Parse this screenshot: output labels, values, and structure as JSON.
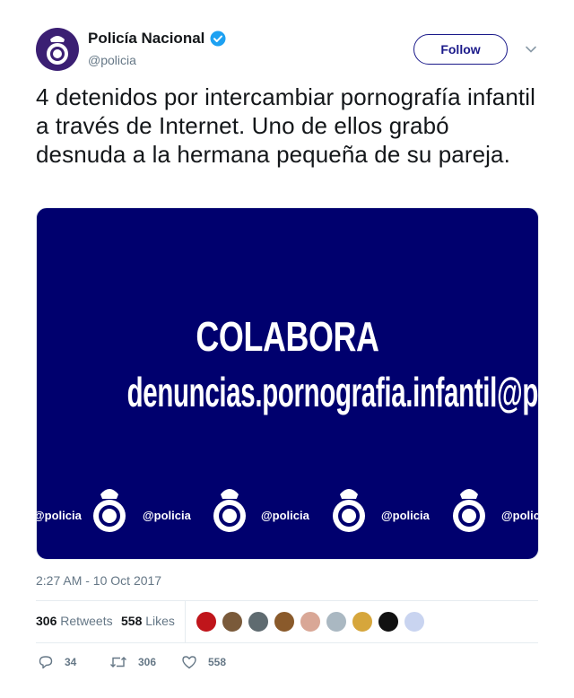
{
  "user": {
    "display_name": "Policía Nacional",
    "handle": "@policia",
    "verified": true,
    "avatar_icon": "police-crest-icon"
  },
  "follow_label": "Follow",
  "tweet_text": "4 detenidos por intercambiar pornografía infantil a través de Internet. Uno de ellos grabó desnuda a la hermana pequeña de su pareja.",
  "media": {
    "headline": "COLABORA",
    "email": "denuncias.pornografia.infantil@policia.es",
    "strip_handle": "@policia",
    "background_color": "#00006e"
  },
  "timestamp": "2:27 AM - 10 Oct 2017",
  "stats": {
    "retweets_count": "306",
    "retweets_label": "Retweets",
    "likes_count": "558",
    "likes_label": "Likes"
  },
  "likers": [
    {
      "color": "#c0151b"
    },
    {
      "color": "#7a5a3a"
    },
    {
      "color": "#5f6b70"
    },
    {
      "color": "#8a5a2b"
    },
    {
      "color": "#d9a796"
    },
    {
      "color": "#aab8c2"
    },
    {
      "color": "#d6a63c"
    },
    {
      "color": "#111111"
    },
    {
      "color": "#c9d4f0"
    }
  ],
  "actions": {
    "reply_count": "34",
    "retweet_count": "306",
    "like_count": "558"
  },
  "colors": {
    "accent": "#1b1a8a",
    "verified": "#1da1f2",
    "muted": "#657786"
  }
}
